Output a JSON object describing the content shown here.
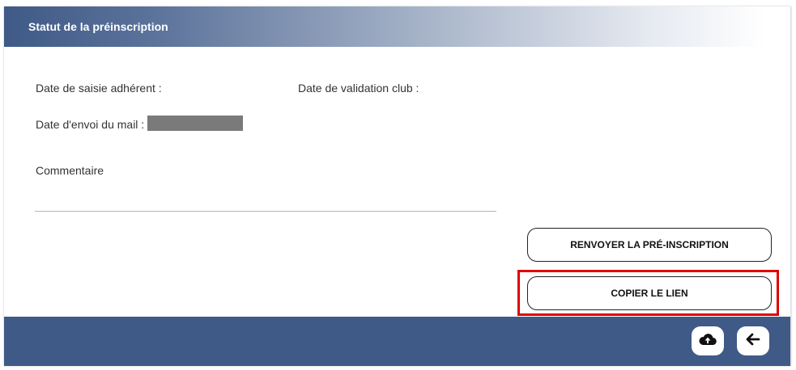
{
  "header": {
    "title": "Statut de la préinscription"
  },
  "fields": {
    "date_saisie_label": "Date de saisie adhérent :",
    "date_validation_label": "Date de validation club :",
    "date_envoi_label": "Date d'envoi du mail :",
    "commentaire_label": "Commentaire"
  },
  "actions": {
    "resend_label": "RENVOYER LA PRÉ-INSCRIPTION",
    "copy_link_label": "COPIER LE LIEN"
  },
  "footer": {
    "icons": [
      "cloud-upload-icon",
      "arrow-left-icon"
    ]
  },
  "colors": {
    "brand": "#3f5a87",
    "highlight": "#e00000"
  }
}
